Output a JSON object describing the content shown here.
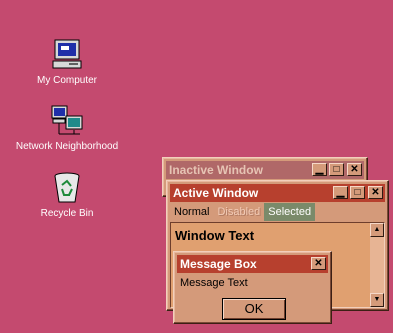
{
  "desktop": {
    "background": "#c44a6f",
    "icons": [
      {
        "label": "My Computer",
        "icon": "computer-icon"
      },
      {
        "label": "Network Neighborhood",
        "icon": "network-icon"
      },
      {
        "label": "Recycle Bin",
        "icon": "recycle-bin-icon"
      }
    ]
  },
  "inactive_window": {
    "title": "Inactive Window",
    "title_color": "#b06868",
    "title_text_color": "#e6c4b4"
  },
  "active_window": {
    "title": "Active Window",
    "title_color": "#b7402e",
    "menu": {
      "normal": "Normal",
      "disabled": "Disabled",
      "selected": "Selected"
    },
    "client_text": "Window Text"
  },
  "message_box": {
    "title": "Message Box",
    "text": "Message Text",
    "ok_label": "OK"
  },
  "controls": {
    "minimize_glyph": "▁",
    "maximize_glyph": "□",
    "close_glyph": "✕",
    "scroll_up_glyph": "▲",
    "scroll_down_glyph": "▼"
  }
}
